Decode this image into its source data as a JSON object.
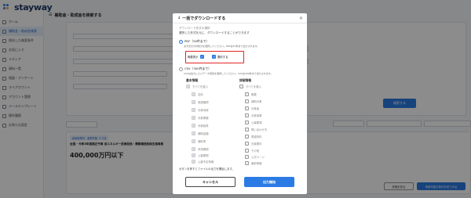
{
  "app": {
    "logo_text": "stayway"
  },
  "sidebar": {
    "items": [
      {
        "label": "ホーム"
      },
      {
        "label": "補助金・助成金検索"
      },
      {
        "label": "保存した検索条件"
      },
      {
        "label": "お気に入り"
      },
      {
        "label": "メディア"
      },
      {
        "label": "資料一覧"
      },
      {
        "label": "相談・アンケート"
      },
      {
        "label": "マイアカウント"
      },
      {
        "label": "アカウント管理"
      },
      {
        "label": "メールテンプレート"
      },
      {
        "label": "操作履歴"
      },
      {
        "label": "お知らせ設定"
      }
    ]
  },
  "main": {
    "page_title": "補助金・助成金を検索する",
    "search_button": "検索する",
    "card": {
      "tag": "経済産業省 - 産業労働, エコ化",
      "title": "全国 - 令和5年度補正予算 省エネルギー投資促進・需要構造転換支援事業",
      "amount": "400,000万円以下",
      "detail_button": "詳細を見る",
      "apply_button": "申請可能な条件を見てみる"
    }
  },
  "modal": {
    "title": "一括でダウンロードする",
    "subtitle": "ダウンロード形式の選択",
    "instruction": "選択した形式を元に、ダウンロードすることができます",
    "pdf_label": "PDF（50件まで）",
    "pdf_note": "必ず表示の対象分を選択してください。PDFは50件まで出力されます。",
    "pdf_option_summary": "概要表示",
    "pdf_option_detail": "要約する",
    "csv_label": "CSV（300件まで）",
    "csv_note": "CSVは出力したいデータ項目を選択してください。CSVは300件まで出力されます。",
    "basic_header": "基本情報",
    "detail_header": "詳細情報",
    "footer_note": "ボタンを押すとファイルの出力を開始します。",
    "cancel_label": "キャンセル",
    "start_label": "出力開始",
    "basic_items": [
      "すべてを選ぶ",
      "名前",
      "実施機関",
      "対象地域",
      "対象業種",
      "対象経費",
      "補助金額",
      "補助率",
      "申請期間",
      "公募期間",
      "公募予定情報"
    ],
    "detail_items": [
      "すべてを選ぶ",
      "概要",
      "補助対象",
      "対象者",
      "対象事業",
      "公募要領",
      "問い合わせ先",
      "関連資料",
      "対象要件",
      "その他",
      "公式ページ",
      "最新情報"
    ]
  }
}
